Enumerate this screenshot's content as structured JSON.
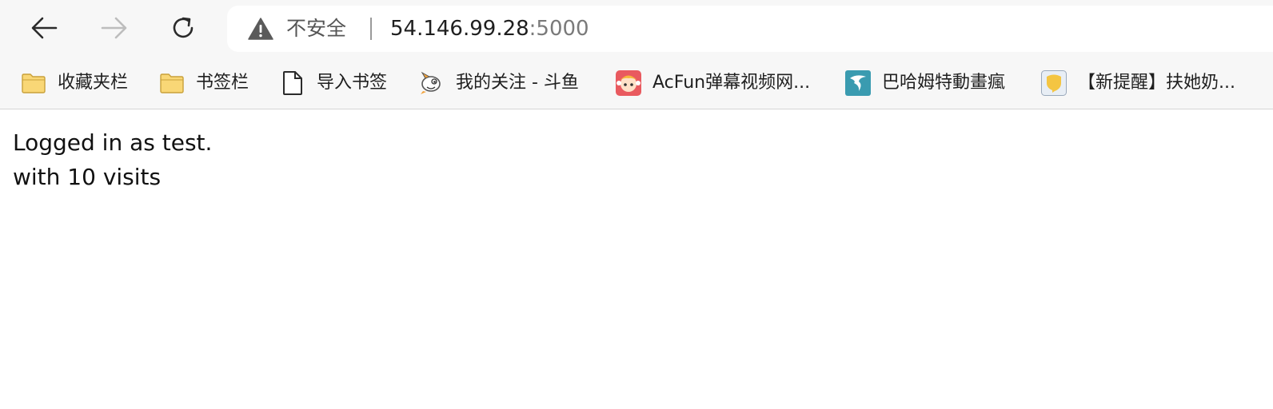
{
  "browser": {
    "security_label": "不安全",
    "url_host": "54.146.99.28",
    "url_port": ":5000",
    "icons": {
      "back": "arrow-left-icon",
      "forward": "arrow-right-icon",
      "reload": "reload-icon",
      "security": "warning-triangle-icon"
    }
  },
  "bookmarks": [
    {
      "label": "收藏夹栏",
      "icon": "folder-icon"
    },
    {
      "label": "书签栏",
      "icon": "folder-icon"
    },
    {
      "label": "导入书签",
      "icon": "document-icon"
    },
    {
      "label": "我的关注 - 斗鱼",
      "icon": "douyu-fish-icon"
    },
    {
      "label": "AcFun弹幕视频网...",
      "icon": "acfun-icon"
    },
    {
      "label": "巴哈姆特動畫瘋",
      "icon": "bahamut-icon"
    },
    {
      "label": "【新提醒】扶她奶...",
      "icon": "forum-icon"
    }
  ],
  "page": {
    "line1": "Logged in as test.",
    "line2": "with 10 visits"
  },
  "colors": {
    "chrome_bg": "#f7f7f7",
    "folder": "#f9d776",
    "acfun": "#e95a5f",
    "bahamut": "#3a9bb0"
  }
}
